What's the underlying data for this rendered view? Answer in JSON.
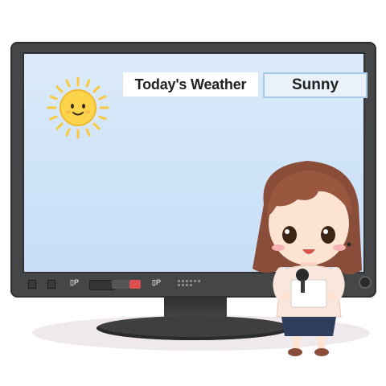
{
  "screen": {
    "title": "Today's Weather",
    "condition": "Sunny"
  },
  "monitor": {
    "control_label_left": "▯P",
    "control_label_right": "▯P"
  },
  "icons": {
    "sun": "sun-icon",
    "power": "power-icon",
    "microphone": "microphone-icon"
  },
  "colors": {
    "bezel": "#454648",
    "screen": "#d4e6f9",
    "sun": "#fbd44b",
    "field_border": "#a9c9e8"
  }
}
